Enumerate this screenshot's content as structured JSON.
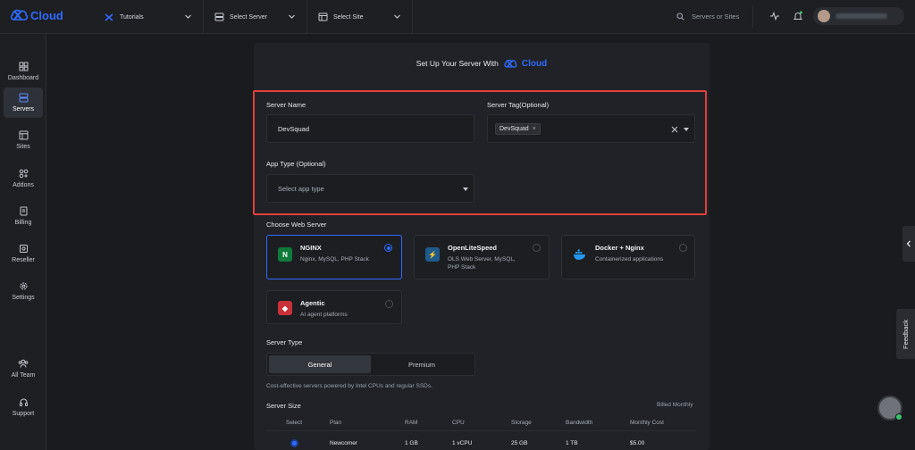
{
  "brand": {
    "name": "Cloud"
  },
  "topbar": {
    "tutorials_label": "Tutorials",
    "select_server_label": "Select Server",
    "select_site_label": "Select Site",
    "search_placeholder": "Servers or Sites"
  },
  "sidebar": {
    "items": [
      {
        "label": "Dashboard",
        "icon": "grid-icon"
      },
      {
        "label": "Servers",
        "icon": "server-icon",
        "active": true
      },
      {
        "label": "Sites",
        "icon": "layout-icon"
      },
      {
        "label": "Addons",
        "icon": "addons-icon"
      },
      {
        "label": "Billing",
        "icon": "receipt-icon"
      },
      {
        "label": "Reseller",
        "icon": "reseller-icon"
      },
      {
        "label": "Settings",
        "icon": "gear-icon"
      },
      {
        "label": "All Team",
        "icon": "team-icon"
      },
      {
        "label": "Support",
        "icon": "headset-icon"
      }
    ]
  },
  "panel": {
    "title_prefix": "Set Up Your Server With",
    "title_brand": "Cloud"
  },
  "form": {
    "server_name_label": "Server Name",
    "server_name_value": "DevSquad",
    "server_tag_label": "Server Tag(Optional)",
    "server_tag_chip": "DevSquad",
    "app_type_label": "App Type (Optional)",
    "app_type_placeholder": "Select app type"
  },
  "web_server": {
    "label": "Choose Web Server",
    "options": [
      {
        "title": "NGINX",
        "desc": "Nginx, MySQL, PHP Stack",
        "selected": true
      },
      {
        "title": "OpenLiteSpeed",
        "desc": "OLS Web Server, MySQL, PHP Stack",
        "selected": false
      },
      {
        "title": "Docker + Nginx",
        "desc": "Containerized applications",
        "selected": false
      },
      {
        "title": "Agentic",
        "desc": "AI agent platforms",
        "selected": false
      }
    ]
  },
  "server_type": {
    "label": "Server Type",
    "options": [
      "General",
      "Premium"
    ],
    "selected": "General",
    "note": "Cost-effective servers powered by Intel CPUs and regular SSDs."
  },
  "server_size": {
    "label": "Server Size",
    "billing_note": "Billed Monthly",
    "columns": [
      "Select",
      "Plan",
      "RAM",
      "CPU",
      "Storage",
      "Bandwidth",
      "Monthly Cost"
    ],
    "rows": [
      {
        "plan": "Newcomer",
        "ram": "1 GB",
        "cpu": "1 vCPU",
        "storage": "25 GB",
        "bandwidth": "1 TB",
        "cost": "$5.00",
        "selected": true
      }
    ]
  },
  "feedback_label": "Feedback",
  "colors": {
    "accent": "#2f6bff",
    "highlight": "#e0403a",
    "background": "#1a1b1f"
  }
}
